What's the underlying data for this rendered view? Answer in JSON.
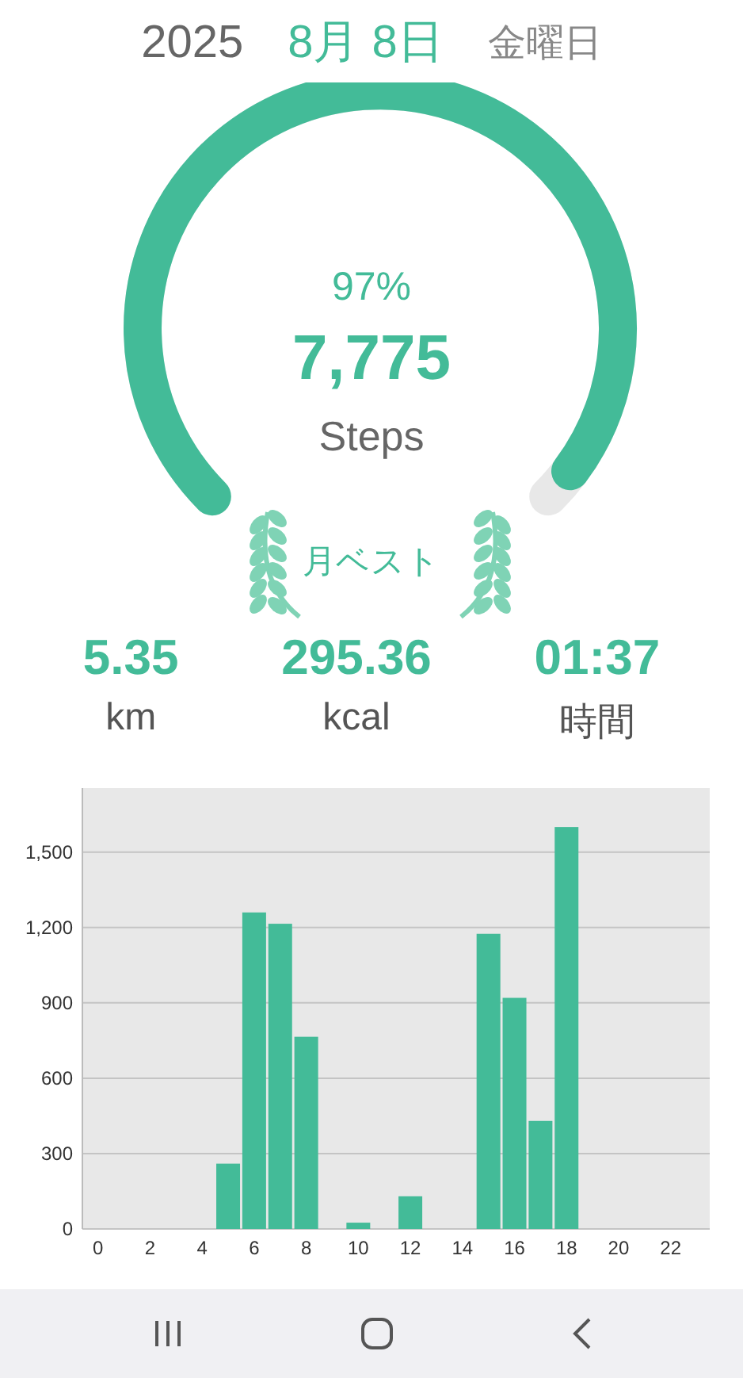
{
  "date": {
    "year": "2025",
    "month_day": "8月 8日",
    "weekday": "金曜日"
  },
  "gauge": {
    "percent": "97%",
    "steps": "7,775",
    "unit": "Steps",
    "badge": "月ベスト"
  },
  "stats": [
    {
      "value": "5.35",
      "label": "km"
    },
    {
      "value": "295.36",
      "label": "kcal"
    },
    {
      "value": "01:37",
      "label": "時間"
    }
  ],
  "chart_data": {
    "type": "bar",
    "x": [
      0,
      1,
      2,
      3,
      4,
      5,
      6,
      7,
      8,
      9,
      10,
      11,
      12,
      13,
      14,
      15,
      16,
      17,
      18,
      19,
      20,
      21,
      22,
      23
    ],
    "grid": true,
    "series": [
      {
        "color": "#43bb98",
        "values": [
          0,
          0,
          0,
          0,
          0,
          260,
          1260,
          1215,
          765,
          0,
          25,
          0,
          130,
          0,
          0,
          1175,
          920,
          430,
          1600,
          0,
          0,
          0,
          0,
          0
        ]
      }
    ],
    "xticks": [
      0,
      2,
      4,
      6,
      8,
      10,
      12,
      14,
      16,
      18,
      20,
      22
    ],
    "yticks": [
      {
        "value": 0,
        "label": "0"
      },
      {
        "value": 300,
        "label": "300"
      },
      {
        "value": 600,
        "label": "600"
      },
      {
        "value": 900,
        "label": "900"
      },
      {
        "value": 1200,
        "label": "1,200"
      },
      {
        "value": 1500,
        "label": "1,500"
      }
    ],
    "ylim": [
      0,
      1755
    ],
    "xlim": [
      -0.6,
      23.5
    ]
  }
}
